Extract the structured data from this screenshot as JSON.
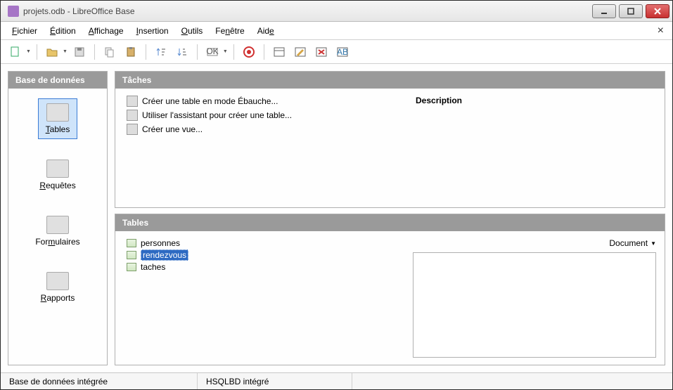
{
  "window": {
    "title": "projets.odb - LibreOffice Base"
  },
  "menu": {
    "items": [
      {
        "label": "Fichier",
        "ul": 0
      },
      {
        "label": "Édition",
        "ul": 0
      },
      {
        "label": "Affichage",
        "ul": 0
      },
      {
        "label": "Insertion",
        "ul": 0
      },
      {
        "label": "Outils",
        "ul": 0
      },
      {
        "label": "Fenêtre",
        "ul": 2
      },
      {
        "label": "Aide",
        "ul": 3
      }
    ]
  },
  "toolbar_icons": [
    "new-doc",
    "open-doc",
    "save-doc",
    "sep",
    "copy",
    "paste",
    "sep",
    "sort-asc",
    "sort-desc",
    "sep",
    "form-design",
    "sep",
    "help",
    "sep",
    "run1",
    "run2",
    "run3",
    "run4"
  ],
  "db_panel": {
    "header": "Base de données",
    "items": [
      {
        "label": "Tables",
        "selected": true,
        "ul": 0
      },
      {
        "label": "Requêtes",
        "selected": false,
        "ul": 0
      },
      {
        "label": "Formulaires",
        "selected": false,
        "ul": 3
      },
      {
        "label": "Rapports",
        "selected": false,
        "ul": 0
      }
    ]
  },
  "tasks_panel": {
    "header": "Tâches",
    "items": [
      "Créer une table en mode Ébauche...",
      "Utiliser l'assistant pour créer une table...",
      "Créer une vue..."
    ],
    "description_header": "Description"
  },
  "tables_panel": {
    "header": "Tables",
    "items": [
      {
        "name": "personnes",
        "selected": false
      },
      {
        "name": "rendezvous",
        "selected": true
      },
      {
        "name": "taches",
        "selected": false
      }
    ],
    "view_mode_label": "Document"
  },
  "statusbar": {
    "left": "Base de données intégrée",
    "mid": "HSQLBD intégré"
  }
}
